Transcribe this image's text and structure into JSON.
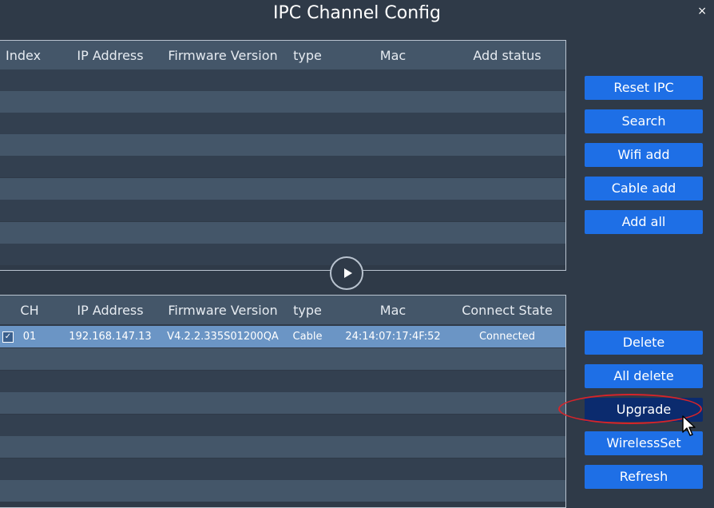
{
  "window": {
    "title": "IPC Channel Config",
    "close_symbol": "×"
  },
  "search_table": {
    "columns": [
      "Index",
      "IP Address",
      "Firmware Version",
      "type",
      "Mac",
      "Add status"
    ]
  },
  "added_table": {
    "columns": [
      "CH",
      "IP Address",
      "Firmware Version",
      "type",
      "Mac",
      "Connect State"
    ],
    "rows": [
      {
        "checked_symbol": "✓",
        "ch": "01",
        "ip": "192.168.147.13",
        "firmware": "V4.2.2.335S01200QA",
        "type": "Cable",
        "mac": "24:14:07:17:4F:52",
        "state": "Connected"
      }
    ]
  },
  "search_buttons": {
    "reset_ipc": "Reset IPC",
    "search": "Search",
    "wifi_add": "Wifi add",
    "cable_add": "Cable add",
    "add_all": "Add all"
  },
  "manage_buttons": {
    "delete": "Delete",
    "all_delete": "All delete",
    "upgrade": "Upgrade",
    "wireless_set": "WirelessSet",
    "refresh": "Refresh"
  },
  "colors": {
    "background": "#2f3a48",
    "button": "#1e6fe6",
    "button_active": "#0b2b6e",
    "selected_row": "#6b95c5",
    "highlight": "#d6242a"
  }
}
